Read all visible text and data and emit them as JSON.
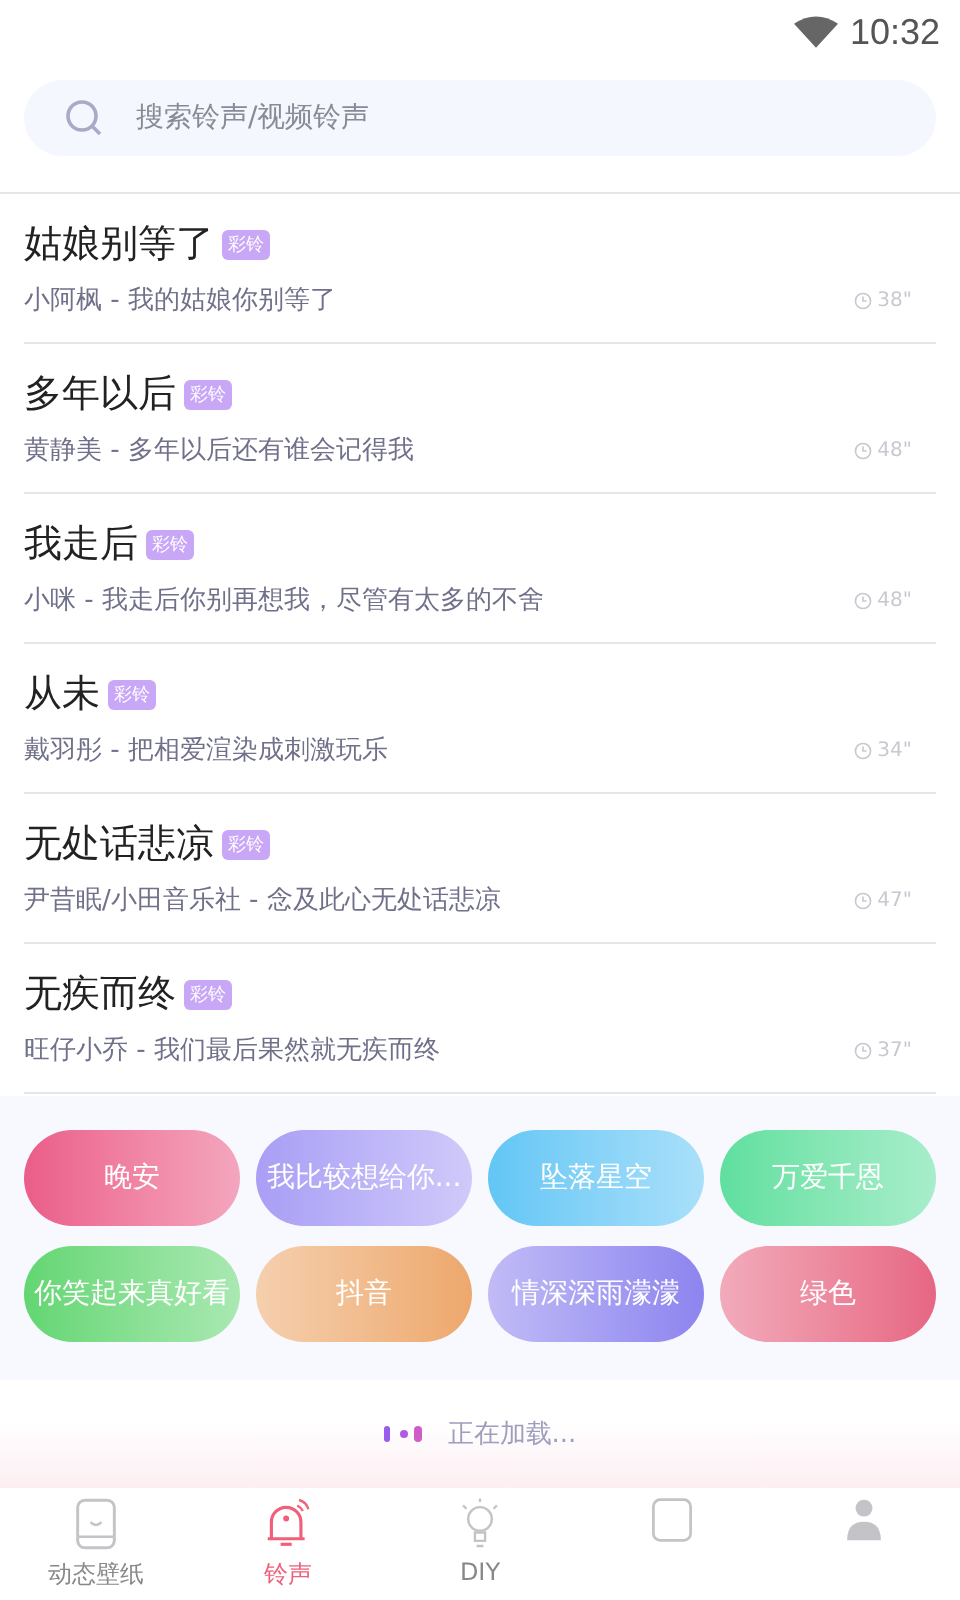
{
  "status_bar": {
    "time": "10:32"
  },
  "search": {
    "placeholder": "搜索铃声/视频铃声"
  },
  "songs": [
    {
      "title": "姑娘别等了",
      "badge": "彩铃",
      "subtitle": "小阿枫 - 我的姑娘你别等了",
      "duration": "38\""
    },
    {
      "title": "多年以后",
      "badge": "彩铃",
      "subtitle": "黄静美 - 多年以后还有谁会记得我",
      "duration": "48\""
    },
    {
      "title": "我走后",
      "badge": "彩铃",
      "subtitle": "小咪 - 我走后你别再想我，尽管有太多的不舍",
      "duration": "48\""
    },
    {
      "title": "从未",
      "badge": "彩铃",
      "subtitle": "戴羽彤 - 把相爱渲染成刺激玩乐",
      "duration": "34\""
    },
    {
      "title": "无处话悲凉",
      "badge": "彩铃",
      "subtitle": "尹昔眠/小田音乐社 - 念及此心无处话悲凉",
      "duration": "47\""
    },
    {
      "title": "无疾而终",
      "badge": "彩铃",
      "subtitle": "旺仔小乔 - 我们最后果然就无疾而终",
      "duration": "37\""
    }
  ],
  "chips": [
    {
      "label": "晚安",
      "color": "#ea5d89"
    },
    {
      "label": "我比较想给你...",
      "color": "#a99ef5"
    },
    {
      "label": "坠落星空",
      "color": "#62c6f5"
    },
    {
      "label": "万爱千恩",
      "color": "#5fdf9f"
    },
    {
      "label": "你笑起来真好看",
      "color": "#62d672"
    },
    {
      "label": "抖音",
      "color": "#eda86c"
    },
    {
      "label": "情深深雨濛濛",
      "color": "#8e84ef"
    },
    {
      "label": "绿色",
      "color": "#e66683"
    }
  ],
  "loading": {
    "text": "正在加载..."
  },
  "tabs": [
    {
      "kind": "wallpaper",
      "label": "动态壁纸",
      "selected": false
    },
    {
      "kind": "ringtone",
      "label": "铃声",
      "selected": true
    },
    {
      "kind": "diy",
      "label": "DIY",
      "selected": false
    },
    {
      "kind": "box",
      "selected": false
    },
    {
      "kind": "person",
      "selected": false
    }
  ]
}
